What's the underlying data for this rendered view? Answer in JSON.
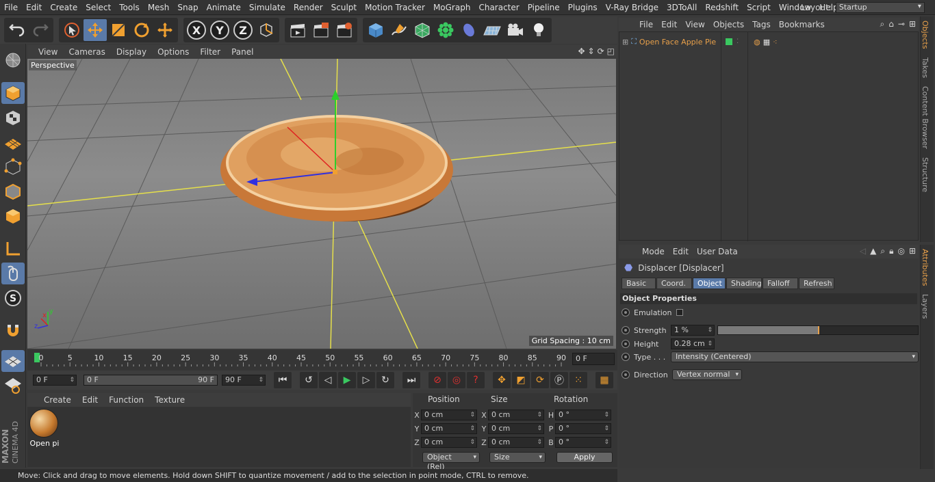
{
  "menubar": {
    "items": [
      "File",
      "Edit",
      "Create",
      "Select",
      "Tools",
      "Mesh",
      "Snap",
      "Animate",
      "Simulate",
      "Render",
      "Sculpt",
      "Motion Tracker",
      "MoGraph",
      "Character",
      "Pipeline",
      "Plugins",
      "V-Ray Bridge",
      "3DToAll",
      "Redshift",
      "Script",
      "Window",
      "Help"
    ],
    "layout_label": "Layout:",
    "layout_value": "Startup"
  },
  "toolbar": {
    "axis_x": "X",
    "axis_y": "Y",
    "axis_z": "Z"
  },
  "viewport": {
    "menu": [
      "View",
      "Cameras",
      "Display",
      "Options",
      "Filter",
      "Panel"
    ],
    "label": "Perspective",
    "grid_spacing": "Grid Spacing : 10 cm",
    "axis_y": "y",
    "axis_x": "x",
    "axis_z": "z"
  },
  "timeline": {
    "ticks": [
      "0",
      "5",
      "10",
      "15",
      "20",
      "25",
      "30",
      "35",
      "40",
      "45",
      "50",
      "55",
      "60",
      "65",
      "70",
      "75",
      "80",
      "85",
      "90"
    ],
    "current_frame": "0 F",
    "start_field": "0 F",
    "range_start": "0 F",
    "range_end": "90 F",
    "end_field": "90 F"
  },
  "material_manager": {
    "menu": [
      "Create",
      "Edit",
      "Function",
      "Texture"
    ],
    "material_name": "Open pi"
  },
  "coordinates": {
    "headers": {
      "position": "Position",
      "size": "Size",
      "rotation": "Rotation"
    },
    "rows": [
      {
        "pl": "X",
        "pv": "0 cm",
        "sl": "X",
        "sv": "0 cm",
        "rl": "H",
        "rv": "0 °"
      },
      {
        "pl": "Y",
        "pv": "0 cm",
        "sl": "Y",
        "sv": "0 cm",
        "rl": "P",
        "rv": "0 °"
      },
      {
        "pl": "Z",
        "pv": "0 cm",
        "sl": "Z",
        "sv": "0 cm",
        "rl": "B",
        "rv": "0 °"
      }
    ],
    "mode": "Object (Rel)",
    "size_mode": "Size",
    "apply": "Apply"
  },
  "status": "Move: Click and drag to move elements. Hold down SHIFT to quantize movement / add to the selection in point mode, CTRL to remove.",
  "object_manager": {
    "menu": [
      "File",
      "Edit",
      "View",
      "Objects",
      "Tags",
      "Bookmarks"
    ],
    "object_name": "Open Face Apple Pie"
  },
  "side_tabs_top": [
    "Objects",
    "Takes",
    "Content Browser",
    "Structure"
  ],
  "side_tabs_bottom": [
    "Attributes",
    "Layers"
  ],
  "attributes": {
    "menu": [
      "Mode",
      "Edit",
      "User Data"
    ],
    "title": "Displacer [Displacer]",
    "tabs": [
      "Basic",
      "Coord.",
      "Object",
      "Shading",
      "Falloff",
      "Refresh"
    ],
    "active_tab": "Object",
    "section": "Object Properties",
    "emulation_label": "Emulation",
    "strength_label": "Strength",
    "strength_value": "1 %",
    "strength_fraction": 0.5,
    "height_label": "Height",
    "height_value": "0.28 cm",
    "type_label": "Type . . .",
    "type_value": "Intensity (Centered)",
    "direction_label": "Direction",
    "direction_value": "Vertex normal"
  },
  "maxon_logo": "MAXON CINEMA 4D",
  "colors": {
    "accent": "#5a7aa8",
    "highlight": "#e8a04a",
    "axis_yellow": "#e6e04a"
  }
}
